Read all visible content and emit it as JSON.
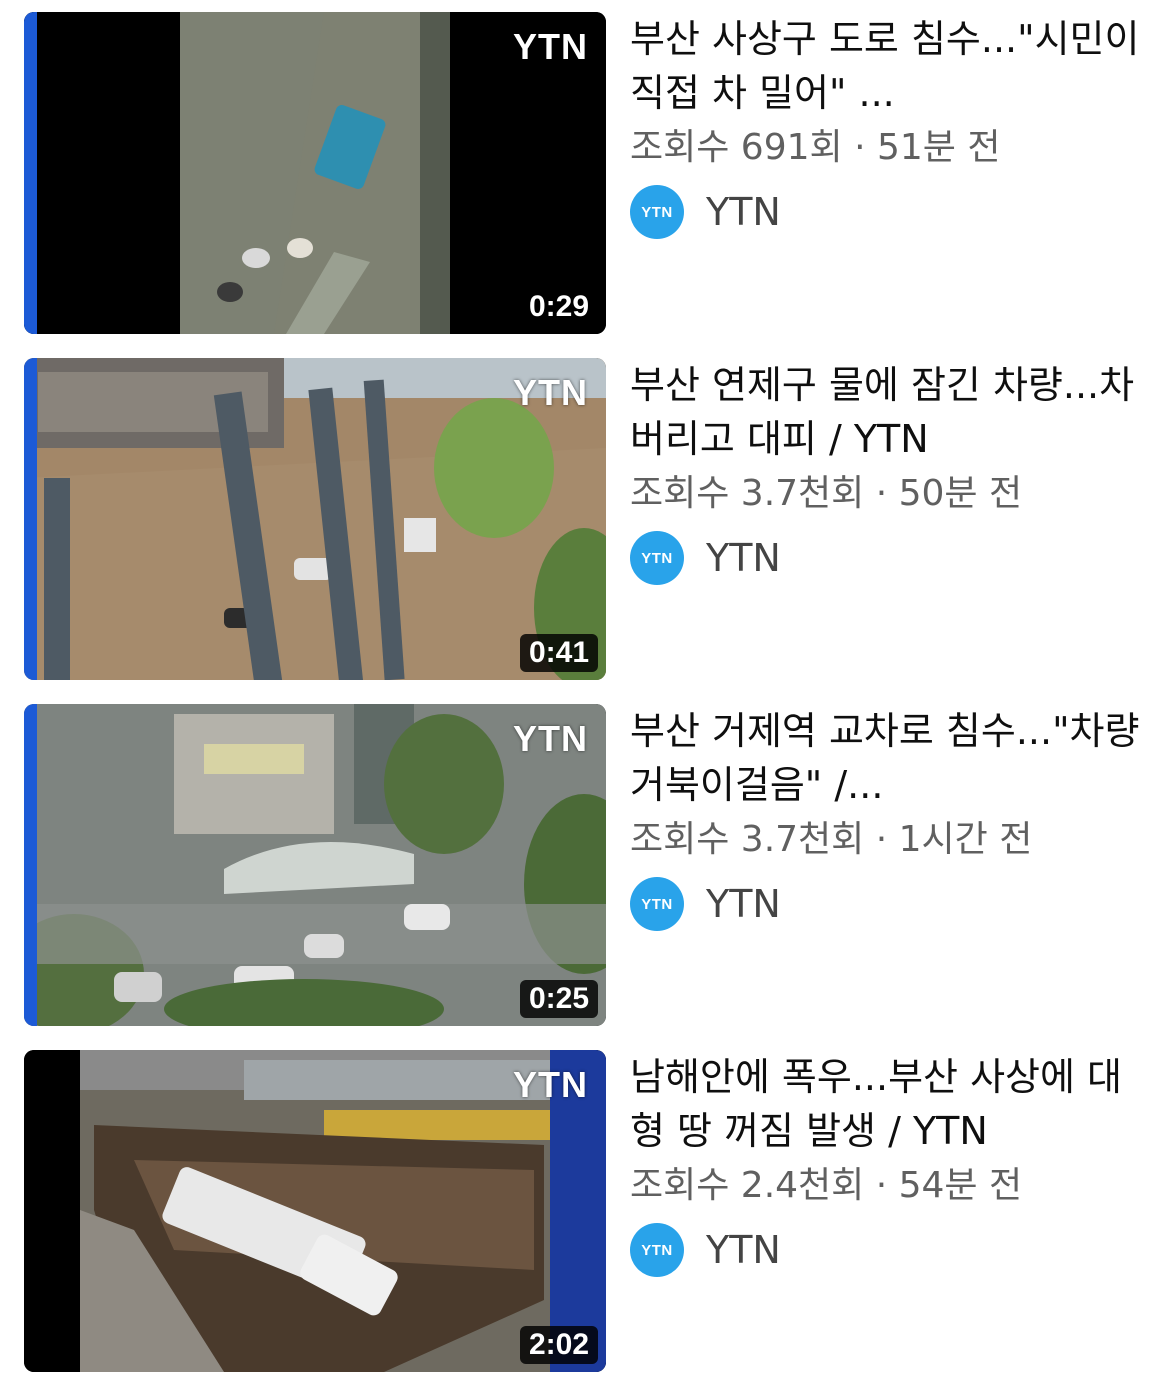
{
  "videos": [
    {
      "title": "부산 사상구 도로 침수...\"시민이 직접 차 밀어\" ...",
      "meta": "조회수 691회 · 51분 전",
      "channel": "YTN",
      "avatar_text": "YTN",
      "duration": "0:29",
      "logo": "YTN"
    },
    {
      "title": "부산 연제구 물에 잠긴 차량...차 버리고 대피 / YTN",
      "meta": "조회수 3.7천회 · 50분 전",
      "channel": "YTN",
      "avatar_text": "YTN",
      "duration": "0:41",
      "logo": "YTN"
    },
    {
      "title": "부산 거제역 교차로 침수...\"차량 거북이걸음\" /...",
      "meta": "조회수 3.7천회 · 1시간 전",
      "channel": "YTN",
      "avatar_text": "YTN",
      "duration": "0:25",
      "logo": "YTN"
    },
    {
      "title": "남해안에 폭우...부산 사상에 대형 땅 꺼짐 발생 / YTN",
      "meta": "조회수 2.4천회 · 54분 전",
      "channel": "YTN",
      "avatar_text": "YTN",
      "duration": "2:02",
      "logo": "YTN"
    }
  ],
  "colors": {
    "accent_edge": "#1c5ad6",
    "avatar_bg": "#29a3ea",
    "meta_text": "#606060"
  }
}
